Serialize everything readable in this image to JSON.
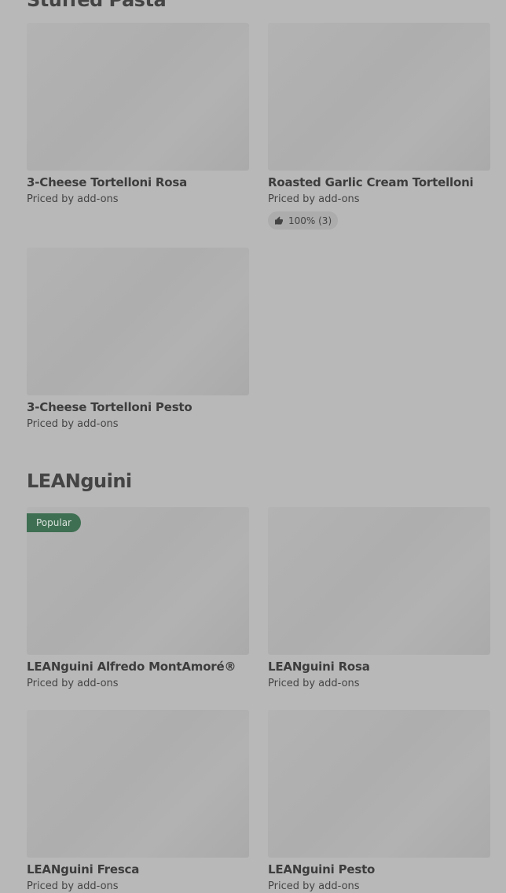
{
  "sections": [
    {
      "title": "Stuffed Pasta",
      "items": [
        {
          "name": "3-Cheese Tortelloni Rosa",
          "price": "Priced by add-ons"
        },
        {
          "name": "Roasted Garlic Cream Tortelloni",
          "price": "Priced by add-ons",
          "rating": "100% (3)"
        },
        {
          "name": "3-Cheese Tortelloni Pesto",
          "price": "Priced by add-ons"
        }
      ]
    },
    {
      "title": "LEANguini",
      "items": [
        {
          "name": "LEANguini Alfredo MontAmoré®",
          "price": "Priced by add-ons",
          "badge": "Popular"
        },
        {
          "name": "LEANguini Rosa",
          "price": "Priced by add-ons"
        },
        {
          "name": "LEANguini Fresca",
          "price": "Priced by add-ons"
        },
        {
          "name": "LEANguini Pesto",
          "price": "Priced by add-ons"
        }
      ]
    }
  ],
  "colors": {
    "badge_bg": "#3f6f52",
    "overlay": "#b8b8b8"
  },
  "icons": {
    "rating": "thumbs-up-icon"
  }
}
